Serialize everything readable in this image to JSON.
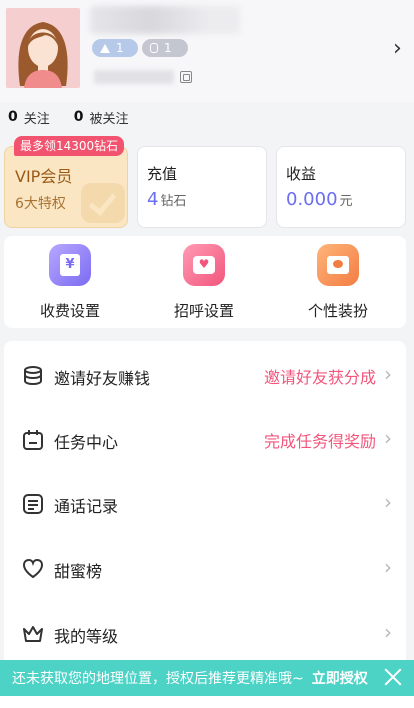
{
  "profile": {
    "badge_level": "1",
    "badge_gem": "1",
    "following_count": "0",
    "following_label": "关注",
    "followers_count": "0",
    "followers_label": "被关注"
  },
  "cards": {
    "promo_tag": "最多领14300钻石",
    "vip_title": "VIP会员",
    "vip_sub": "6大特权",
    "recharge_title": "充值",
    "recharge_value": "4",
    "recharge_unit": "钻石",
    "earnings_title": "收益",
    "earnings_value": "0.000",
    "earnings_unit": "元"
  },
  "settings": [
    {
      "label": "收费设置",
      "icon": "fee-settings-icon"
    },
    {
      "label": "招呼设置",
      "icon": "greeting-settings-icon"
    },
    {
      "label": "个性装扮",
      "icon": "dress-up-icon"
    }
  ],
  "menu": [
    {
      "label": "邀请好友赚钱",
      "right": "邀请好友获分成",
      "icon": "coins-icon"
    },
    {
      "label": "任务中心",
      "right": "完成任务得奖励",
      "icon": "calendar-icon"
    },
    {
      "label": "通话记录",
      "right": "",
      "icon": "record-icon"
    },
    {
      "label": "甜蜜榜",
      "right": "",
      "icon": "heart-icon"
    },
    {
      "label": "我的等级",
      "right": "",
      "icon": "crown-icon"
    }
  ],
  "banner": {
    "message": "还未获取您的地理位置，授权后推荐更精准哦~",
    "action": "立即授权"
  },
  "colors": {
    "accent_pink": "#f2536e",
    "accent_purple": "#6a6ef0",
    "vip_gold": "#fbe6c4",
    "banner_teal": "#4dd2c6"
  }
}
